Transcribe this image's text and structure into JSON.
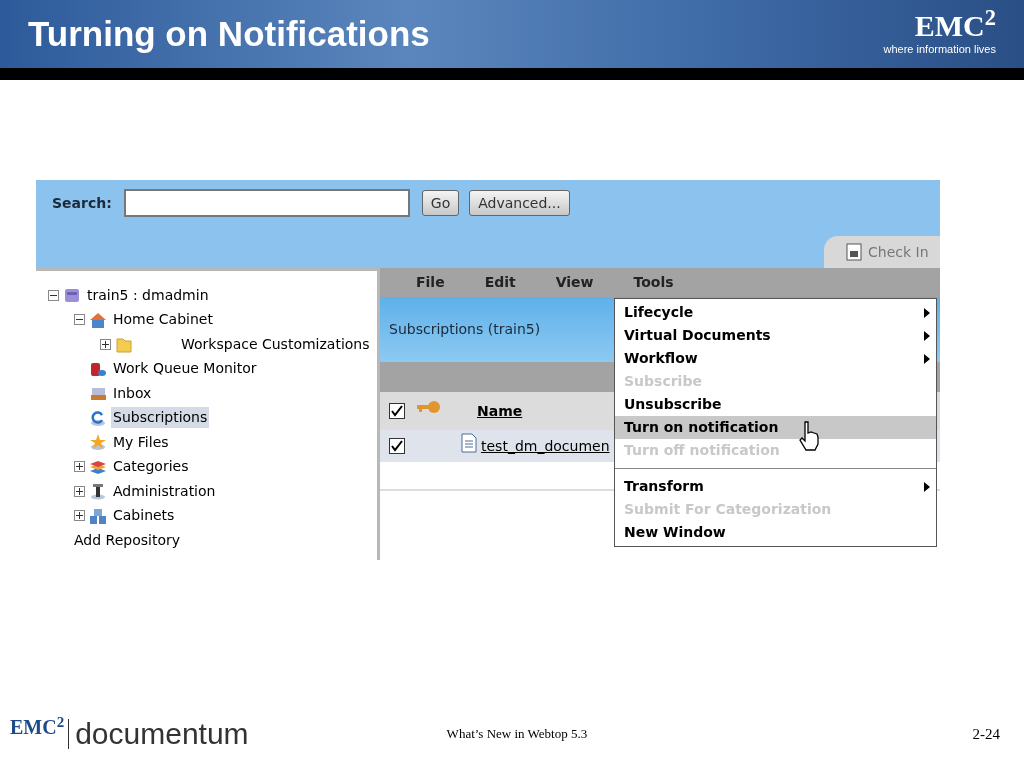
{
  "slide": {
    "title": "Turning on Notifications",
    "logo": "EMC$^{2}$",
    "tagline": "where information lives"
  },
  "app": {
    "search": {
      "label": "Search:"
    },
    "buttons": [
      "Go",
      "Advanced..."
    ],
    "check_in": "Check In",
    "tree": [
      {
        "label": "train5 : dmadmin",
        "expanded": true,
        "selected": false,
        "children": [
          {
            "label": "Home Cabinet",
            "expanded": true,
            "selected": false,
            "children": [
              {
                "label": "Workspace Customizations",
                "expanded": false,
                "selected": false
              }
            ]
          },
          {
            "label": "Work Queue Monitor",
            "selected": false
          },
          {
            "label": "Inbox",
            "selected": false
          },
          {
            "label": "Subscriptions",
            "selected": true
          },
          {
            "label": "My Files",
            "selected": false
          },
          {
            "label": "Categories",
            "expanded": false,
            "selected": false
          },
          {
            "label": "Administration",
            "expanded": false,
            "selected": false
          },
          {
            "label": "Cabinets",
            "expanded": false,
            "selected": false
          }
        ]
      }
    ],
    "add_repository": "Add Repository",
    "menubar": [
      "File",
      "Edit",
      "View",
      "Tools"
    ],
    "panel_title": "Subscriptions (train5)",
    "table": {
      "header_checked": true,
      "column": "Name",
      "rows": [
        {
          "name": "test_dm_documen",
          "checked": true
        }
      ]
    },
    "menu": [
      {
        "kind": "item",
        "label": "Lifecycle",
        "disabled": false,
        "selected": false,
        "submenu": true
      },
      {
        "kind": "item",
        "label": "Virtual Documents",
        "disabled": false,
        "selected": false,
        "submenu": true
      },
      {
        "kind": "item",
        "label": "Workflow",
        "disabled": false,
        "selected": false,
        "submenu": true
      },
      {
        "kind": "item",
        "label": "Subscribe",
        "disabled": true,
        "selected": false,
        "submenu": false
      },
      {
        "kind": "item",
        "label": "Unsubscribe",
        "disabled": false,
        "selected": false,
        "submenu": false
      },
      {
        "kind": "item",
        "label": "Turn on notification",
        "disabled": false,
        "selected": true,
        "submenu": false
      },
      {
        "kind": "item",
        "label": "Turn off notification",
        "disabled": true,
        "selected": false,
        "submenu": false
      },
      {
        "kind": "separator"
      },
      {
        "kind": "item",
        "label": "Transform",
        "disabled": false,
        "selected": false,
        "submenu": true
      },
      {
        "kind": "item",
        "label": "Submit For Categorization",
        "disabled": true,
        "selected": false,
        "submenu": false
      },
      {
        "kind": "item",
        "label": "New Window",
        "disabled": false,
        "selected": false,
        "submenu": false
      }
    ]
  },
  "footer": {
    "logo": "EMC$^{2}$",
    "product": "documentum",
    "caption": "What’s New in Webtop 5.3",
    "page": "2-24"
  }
}
